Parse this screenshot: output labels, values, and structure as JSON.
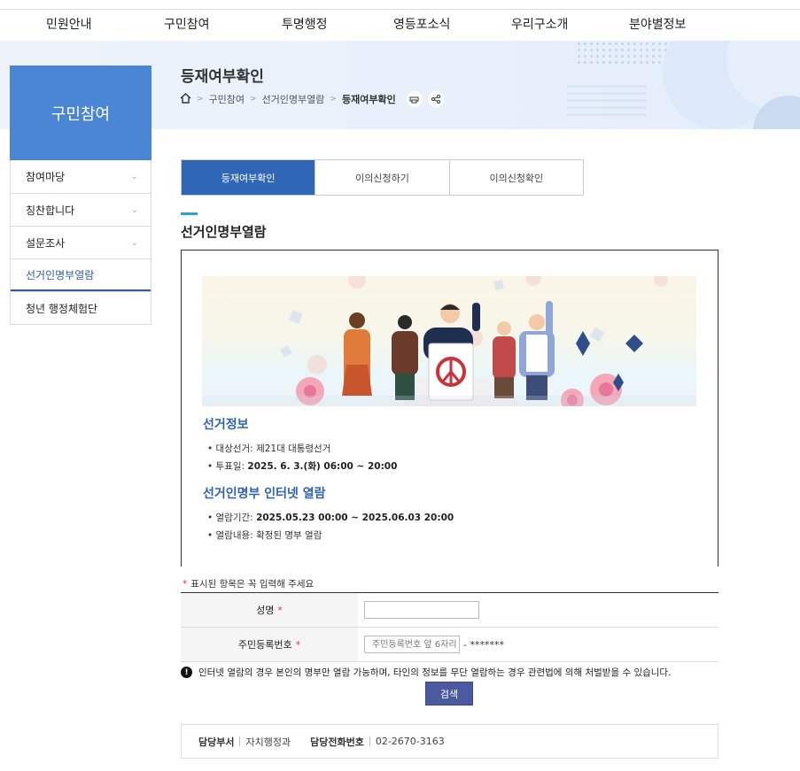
{
  "gnb": [
    "민원안내",
    "구민참여",
    "투명행정",
    "영등포소식",
    "우리구소개",
    "분야별정보"
  ],
  "page": {
    "title": "등재여부확인",
    "breadcrumb": [
      "구민참여",
      "선거인명부열람",
      "등재여부확인"
    ]
  },
  "sidebar": {
    "title": "구민참여",
    "items": [
      {
        "label": "참여마당"
      },
      {
        "label": "칭찬합니다"
      },
      {
        "label": "설문조사"
      },
      {
        "label": "선거인명부열람"
      },
      {
        "label": "청년 행정체험단"
      }
    ]
  },
  "tabs": [
    "등재여부확인",
    "이의신청하기",
    "이의신청확인"
  ],
  "section": {
    "title": "선거인명부열람"
  },
  "election": {
    "heading": "선거정보",
    "items": [
      {
        "label": "대상선거:",
        "value": "제21대 대통령선거"
      },
      {
        "label": "투표일:",
        "value": "2025. 6. 3.(화) 06:00 ~ 20:00"
      }
    ]
  },
  "internet": {
    "heading": "선거인명부 인터넷 열람",
    "items": [
      {
        "label": "열람기간:",
        "value": "2025.05.23 00:00 ~ 2025.06.03 20:00"
      },
      {
        "label": "열람내용:",
        "value": "확정된 명부 열람"
      }
    ]
  },
  "form": {
    "required_note": "표시된 항목은 꼭 입력해 주세요",
    "required_mark": "*",
    "name_label": "성명",
    "name_value": "",
    "rrn_label": "주민등록번호",
    "rrn_placeholder": "주민등록번호 앞 6자리",
    "rrn_masked": "- *******"
  },
  "warning": {
    "icon": "!",
    "text": "인터넷 열람의 경우 본인의 명부만 열람 가능하며, 타인의 정보를 무단 열람하는 경우 관련법에 의해 처벌받을 수 있습니다."
  },
  "search_label": "검색",
  "contact": {
    "dept_label": "담당부서",
    "dept_value": "자치행정과",
    "phone_label": "담당전화번호",
    "phone_value": "02-2670-3163"
  },
  "colors": {
    "primary": "#4a86d4",
    "tab_active": "#2f67b6",
    "accent": "#25a6c3",
    "button": "#4b5a9f"
  }
}
